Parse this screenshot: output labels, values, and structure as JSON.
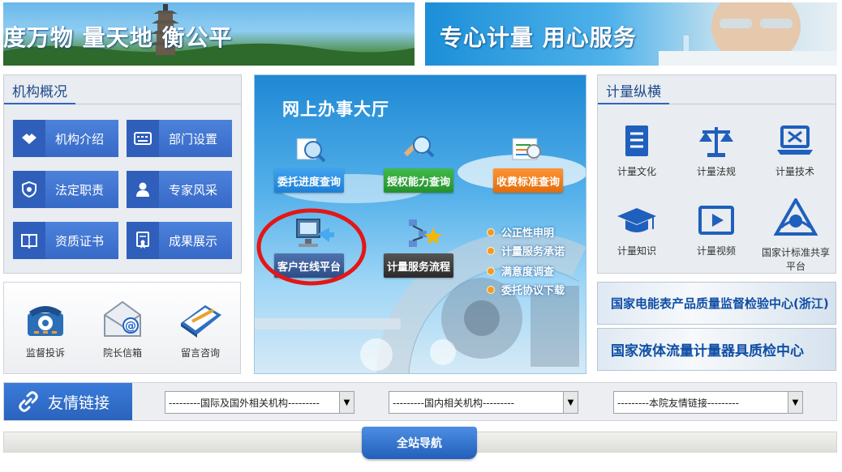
{
  "banners": {
    "left_slogan": "度万物   量天地   衡公平",
    "right_slogan": "专心计量   用心服务"
  },
  "org_panel": {
    "title": "机构概况",
    "items": [
      {
        "label": "机构介绍",
        "icon": "handshake-icon"
      },
      {
        "label": "部门设置",
        "icon": "keyboard-icon"
      },
      {
        "label": "法定职责",
        "icon": "badge-icon"
      },
      {
        "label": "专家风采",
        "icon": "person-icon"
      },
      {
        "label": "资质证书",
        "icon": "book-icon"
      },
      {
        "label": "成果展示",
        "icon": "certificate-icon"
      }
    ]
  },
  "hall": {
    "title": "网上办事大厅",
    "buttons": [
      {
        "label": "委托进度查询",
        "color": "#2a8de0"
      },
      {
        "label": "授权能力查询",
        "color": "#2f9e3a"
      },
      {
        "label": "收费标准查询",
        "color": "#f07c1c"
      },
      {
        "label": "客户在线平台",
        "color": "#3d5f9c"
      },
      {
        "label": "计量服务流程",
        "color": "#3b3b3b"
      }
    ],
    "links": [
      "公正性申明",
      "计量服务承诺",
      "满意度调查",
      "委托协议下载"
    ],
    "circled_item": "客户在线平台"
  },
  "metrology_panel": {
    "title": "计量纵横",
    "items": [
      {
        "label": "计量文化",
        "icon": "document-icon"
      },
      {
        "label": "计量法规",
        "icon": "scales-icon"
      },
      {
        "label": "计量技术",
        "icon": "laptop-tools-icon"
      },
      {
        "label": "计量知识",
        "icon": "graduation-cap-icon"
      },
      {
        "label": "计量视频",
        "icon": "video-play-icon"
      },
      {
        "label": "国家计标准共享平台",
        "icon": "share-platform-icon"
      }
    ]
  },
  "contact_panel": {
    "items": [
      {
        "label": "监督投诉",
        "icon": "telephone-icon"
      },
      {
        "label": "院长信箱",
        "icon": "mail-icon"
      },
      {
        "label": "留言咨询",
        "icon": "notepad-icon"
      }
    ]
  },
  "center_banners": [
    "国家电能表产品质量监督检验中心(浙江)",
    "国家液体流量计量器具质检中心"
  ],
  "links": {
    "title": "友情链接",
    "selects": [
      "---------国际及国外相关机构---------",
      "---------国内相关机构---------",
      "---------本院友情链接---------"
    ]
  },
  "footer": {
    "nav_label": "全站导航"
  }
}
